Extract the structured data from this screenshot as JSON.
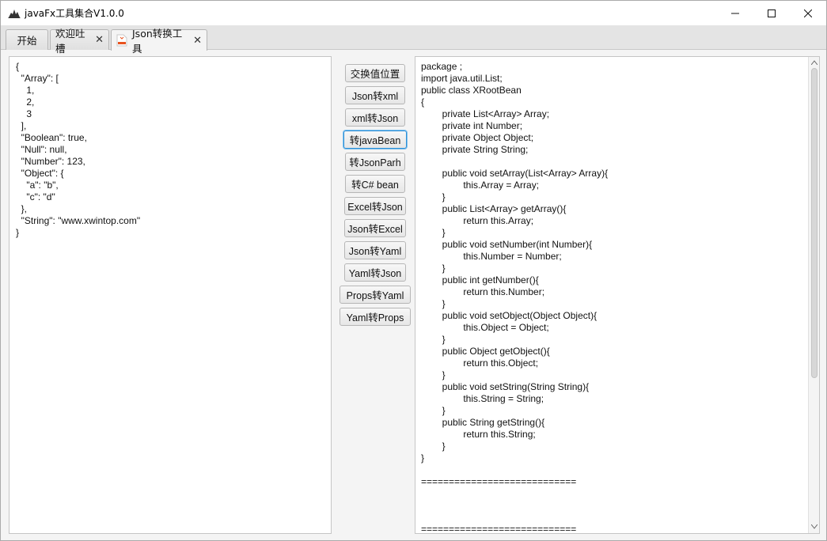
{
  "window": {
    "title": "javaFx工具集合V1.0.0",
    "minimize_label": "—",
    "maximize_label": "☐",
    "close_label": "✕"
  },
  "tabs": [
    {
      "label": "开始",
      "closable": false
    },
    {
      "label": "欢迎吐槽",
      "closable": true
    },
    {
      "label": "Json转换工具",
      "closable": true,
      "active": true
    }
  ],
  "tab_close_glyph": "✕",
  "input_json": "{\n  \"Array\": [\n    1,\n    2,\n    3\n  ],\n  \"Boolean\": true,\n  \"Null\": null,\n  \"Number\": 123,\n  \"Object\": {\n    \"a\": \"b\",\n    \"c\": \"d\"\n  },\n  \"String\": \"www.xwintop.com\"\n}",
  "buttons": [
    {
      "label": "交换值位置"
    },
    {
      "label": "Json转xml"
    },
    {
      "label": "xml转Json"
    },
    {
      "label": "转javaBean",
      "focused": true
    },
    {
      "label": "转JsonParh"
    },
    {
      "label": "转C# bean"
    },
    {
      "label": "Excel转Json"
    },
    {
      "label": "Json转Excel"
    },
    {
      "label": "Json转Yaml"
    },
    {
      "label": "Yaml转Json"
    },
    {
      "label": "Props转Yaml"
    },
    {
      "label": "Yaml转Props"
    }
  ],
  "output_code": "package ;\nimport java.util.List;\npublic class XRootBean\n{\n        private List<Array> Array;\n        private int Number;\n        private Object Object;\n        private String String;\n\n        public void setArray(List<Array> Array){\n                this.Array = Array;\n        }\n        public List<Array> getArray(){\n                return this.Array;\n        }\n        public void setNumber(int Number){\n                this.Number = Number;\n        }\n        public int getNumber(){\n                return this.Number;\n        }\n        public void setObject(Object Object){\n                this.Object = Object;\n        }\n        public Object getObject(){\n                return this.Object;\n        }\n        public void setString(String String){\n                this.String = String;\n        }\n        public String getString(){\n                return this.String;\n        }\n}\n\n============================\n\n\n\n============================\npackage ;",
  "colors": {
    "focus_border": "#2b8fd6",
    "tab_icon": "#e8531f"
  }
}
